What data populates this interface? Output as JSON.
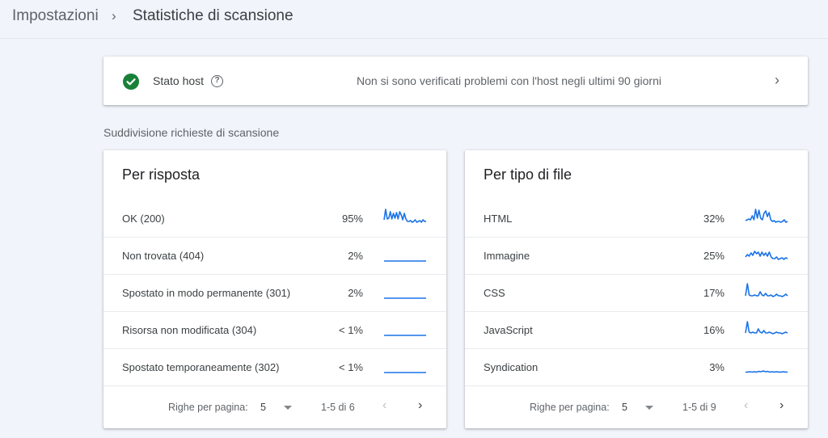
{
  "header": {
    "breadcrumb_root": "Impostazioni",
    "breadcrumb_separator": "›",
    "page_title": "Statistiche di scansione"
  },
  "host_status": {
    "icon": "check-circle-icon",
    "label": "Stato host",
    "help_icon": "?",
    "message": "Non si sono verificati problemi con l'host negli ultimi 90 giorni",
    "chevron": "›",
    "status_color": "#188038"
  },
  "section_label": "Suddivisione richieste di scansione",
  "spark_color": "#1a73e8",
  "panels": [
    {
      "title": "Per risposta",
      "rows": [
        {
          "label": "OK (200)",
          "pct": "95%",
          "trend": [
            0.3,
            0.95,
            0.35,
            0.4,
            0.8,
            0.35,
            0.7,
            0.4,
            0.75,
            0.35,
            0.8,
            0.6,
            0.3,
            0.7,
            0.35,
            0.2,
            0.2,
            0.25,
            0.15,
            0.2,
            0.3,
            0.15,
            0.2,
            0.25,
            0.15,
            0.3,
            0.2,
            0.2
          ]
        },
        {
          "label": "Non trovata (404)",
          "pct": "2%",
          "trend": [
            0.05,
            0.05,
            0.05,
            0.05,
            0.05,
            0.05,
            0.05,
            0.05,
            0.05,
            0.05,
            0.05,
            0.05,
            0.05,
            0.05,
            0.05,
            0.05
          ]
        },
        {
          "label": "Spostato in modo permanente (301)",
          "pct": "2%",
          "trend": [
            0.05,
            0.05,
            0.05,
            0.05,
            0.05,
            0.05,
            0.05,
            0.05,
            0.05,
            0.05,
            0.05,
            0.05,
            0.05,
            0.05,
            0.05,
            0.05
          ]
        },
        {
          "label": "Risorsa non modificata (304)",
          "pct": "< 1%",
          "trend": [
            0.05,
            0.05,
            0.05,
            0.05,
            0.05,
            0.05,
            0.05,
            0.05,
            0.05,
            0.05,
            0.05,
            0.05,
            0.05,
            0.05,
            0.05,
            0.05
          ]
        },
        {
          "label": "Spostato temporaneamente (302)",
          "pct": "< 1%",
          "trend": [
            0.05,
            0.05,
            0.05,
            0.05,
            0.05,
            0.05,
            0.05,
            0.05,
            0.05,
            0.05,
            0.05,
            0.05,
            0.05,
            0.05,
            0.05,
            0.05
          ]
        }
      ],
      "pager": {
        "rows_label": "Righe per pagina:",
        "rows_value": "5",
        "range": "1-5 di 6",
        "prev": "‹",
        "next": "›"
      }
    },
    {
      "title": "Per tipo di file",
      "rows": [
        {
          "label": "HTML",
          "pct": "32%",
          "trend": [
            0.25,
            0.3,
            0.35,
            0.3,
            0.55,
            0.3,
            0.95,
            0.4,
            0.9,
            0.4,
            0.3,
            0.7,
            0.85,
            0.5,
            0.75,
            0.3,
            0.2,
            0.25,
            0.15,
            0.2,
            0.2,
            0.15,
            0.2,
            0.3,
            0.15,
            0.2
          ]
        },
        {
          "label": "Immagine",
          "pct": "25%",
          "trend": [
            0.3,
            0.45,
            0.35,
            0.55,
            0.4,
            0.65,
            0.5,
            0.6,
            0.35,
            0.6,
            0.4,
            0.55,
            0.35,
            0.6,
            0.3,
            0.2,
            0.2,
            0.3,
            0.15,
            0.2,
            0.25,
            0.15,
            0.25,
            0.2
          ]
        },
        {
          "label": "CSS",
          "pct": "17%",
          "trend": [
            0.2,
            0.95,
            0.25,
            0.2,
            0.2,
            0.25,
            0.2,
            0.2,
            0.45,
            0.25,
            0.2,
            0.35,
            0.2,
            0.2,
            0.25,
            0.15,
            0.2,
            0.3,
            0.2,
            0.2,
            0.15,
            0.2,
            0.3,
            0.2
          ]
        },
        {
          "label": "JavaScript",
          "pct": "16%",
          "trend": [
            0.2,
            0.9,
            0.25,
            0.2,
            0.25,
            0.2,
            0.2,
            0.45,
            0.25,
            0.2,
            0.35,
            0.2,
            0.2,
            0.25,
            0.2,
            0.15,
            0.2,
            0.25,
            0.2,
            0.2,
            0.15,
            0.2,
            0.25,
            0.2
          ]
        },
        {
          "label": "Syndication",
          "pct": "3%",
          "trend": [
            0.08,
            0.08,
            0.1,
            0.08,
            0.1,
            0.08,
            0.12,
            0.1,
            0.15,
            0.1,
            0.12,
            0.08,
            0.1,
            0.08,
            0.1,
            0.08,
            0.08,
            0.1,
            0.08,
            0.08
          ]
        }
      ],
      "pager": {
        "rows_label": "Righe per pagina:",
        "rows_value": "5",
        "range": "1-5 di 9",
        "prev": "‹",
        "next": "›"
      }
    }
  ]
}
